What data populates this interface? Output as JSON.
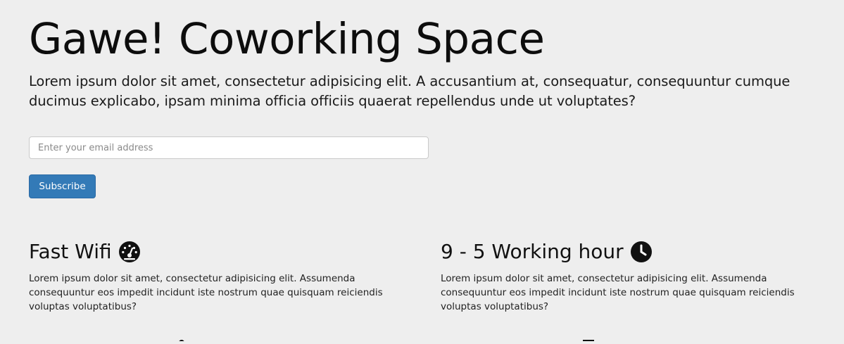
{
  "hero": {
    "title": "Gawe! Coworking Space",
    "lead": "Lorem ipsum dolor sit amet, consectetur adipisicing elit. A accusantium at, consequatur, consequuntur cumque ducimus explicabo, ipsam minima officia officiis quaerat repellendus unde ut voluptates?"
  },
  "subscribe": {
    "email_placeholder": "Enter your email address",
    "button_label": "Subscribe"
  },
  "features": [
    {
      "title": "Fast Wifi",
      "icon": "speedometer-icon",
      "text": "Lorem ipsum dolor sit amet, consectetur adipisicing elit. Assumenda consequuntur eos impedit incidunt iste nostrum quae quisquam reiciendis voluptas voluptatibus?"
    },
    {
      "title": "9 - 5 Working hour",
      "icon": "clock-icon",
      "text": "Lorem ipsum dolor sit amet, consectetur adipisicing elit. Assumenda consequuntur eos impedit incidunt iste nostrum quae quisquam reiciendis voluptas voluptatibus?"
    }
  ],
  "colors": {
    "background": "#eeeeee",
    "primary_button": "#337ab7",
    "text": "#111111"
  }
}
